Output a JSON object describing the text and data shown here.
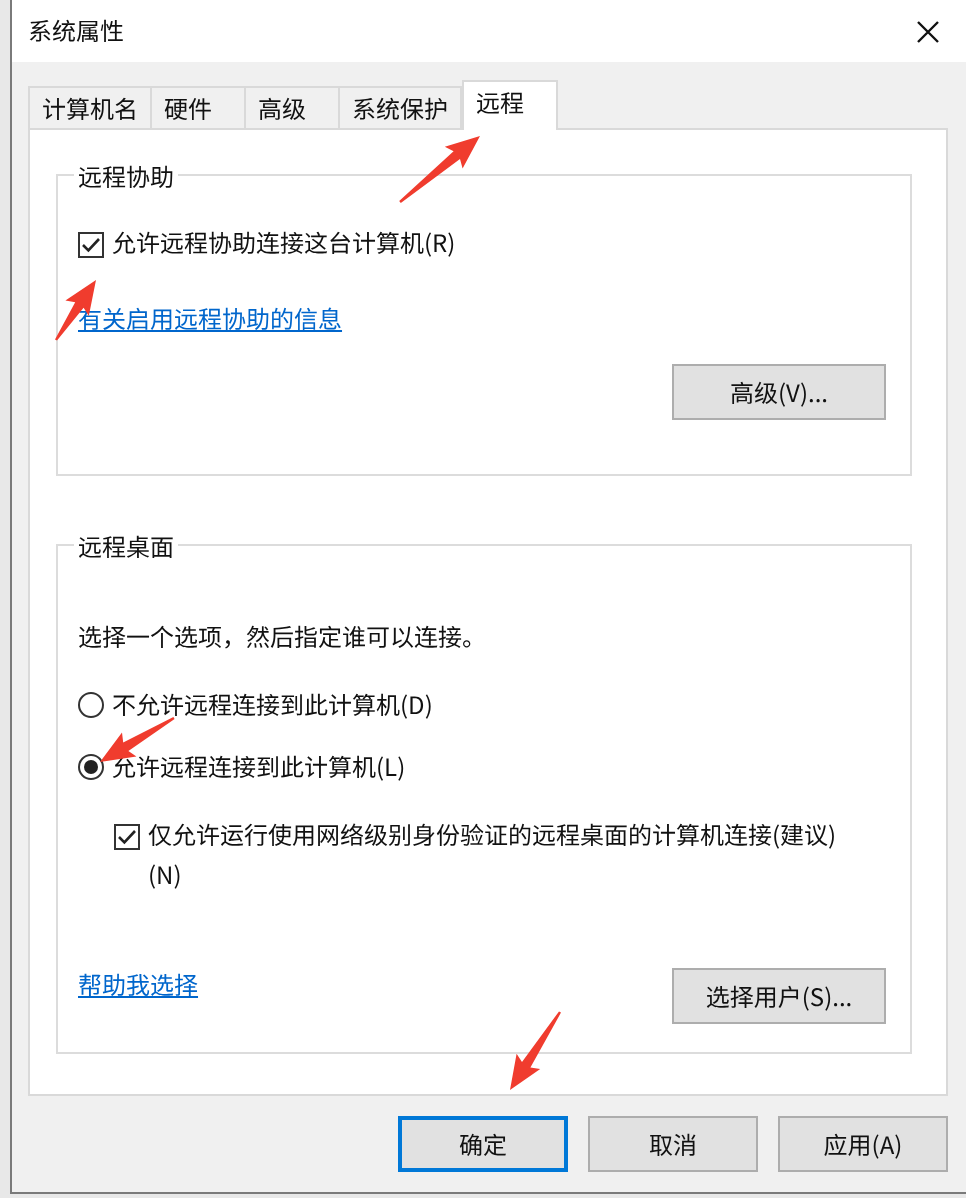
{
  "window": {
    "title": "系统属性"
  },
  "tabs": [
    {
      "label": "计算机名",
      "selected": false
    },
    {
      "label": "硬件",
      "selected": false
    },
    {
      "label": "高级",
      "selected": false
    },
    {
      "label": "系统保护",
      "selected": false
    },
    {
      "label": "远程",
      "selected": true
    }
  ],
  "remote_assistance": {
    "title": "远程协助",
    "allow": {
      "label": "允许远程协助连接这台计算机(R)",
      "checked": true
    },
    "link": "有关启用远程协助的信息",
    "button": "高级(V)..."
  },
  "remote_desktop": {
    "title": "远程桌面",
    "instruction": "选择一个选项，然后指定谁可以连接。",
    "options": [
      {
        "label": "不允许远程连接到此计算机(D)",
        "selected": false
      },
      {
        "label": "允许远程连接到此计算机(L)",
        "selected": true
      }
    ],
    "nla": {
      "label": "仅允许运行使用网络级别身份验证的远程桌面的计算机连接(建议)(N)",
      "checked": true
    },
    "link": "帮助我选择",
    "button": "选择用户(S)..."
  },
  "buttons": [
    {
      "label": "确定",
      "default": true
    },
    {
      "label": "取消",
      "default": false
    },
    {
      "label": "应用(A)",
      "default": false
    }
  ]
}
